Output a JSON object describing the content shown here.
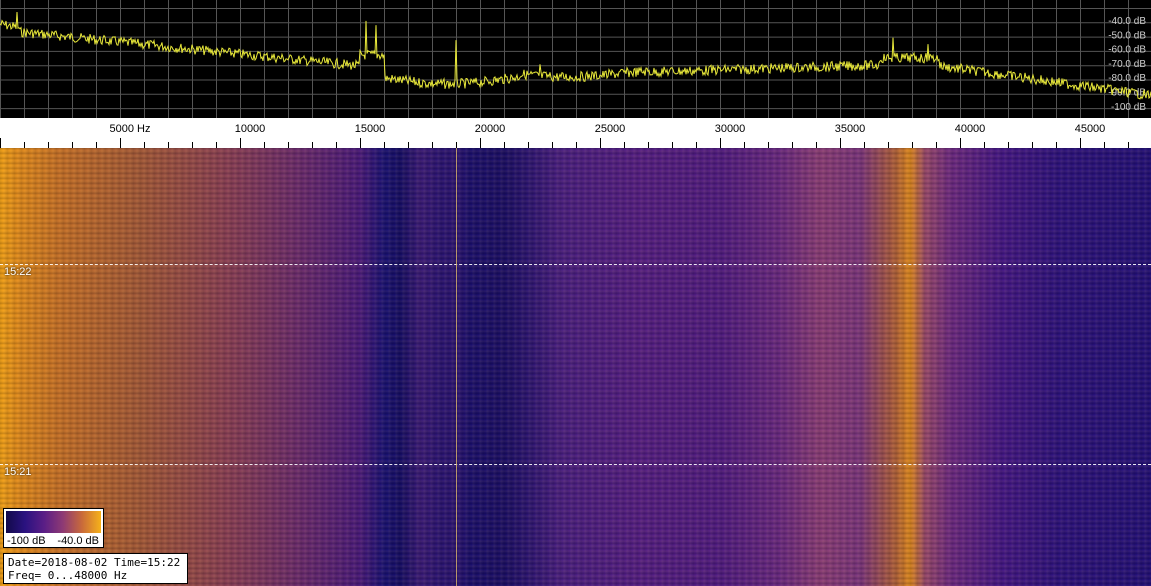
{
  "spectrum": {
    "db_labels": [
      "-40.0 dB",
      "-50.0 dB",
      "-60.0 dB",
      "-70.0 dB",
      "-80.0 dB",
      "-90.0 dB",
      "-100 dB"
    ],
    "trace_color": "#e8e83a",
    "grid_color": "#555555",
    "background": "#000000"
  },
  "axis": {
    "freq_labels": [
      "5000 Hz",
      "10000",
      "15000",
      "20000",
      "25000",
      "30000",
      "35000",
      "40000",
      "45000"
    ]
  },
  "waterfall": {
    "time_markers": [
      "15:22",
      "15:21"
    ],
    "marker_color": "#e7c36a"
  },
  "colorbar": {
    "min_label": "-100 dB",
    "max_label": "-40.0 dB"
  },
  "info": {
    "date_line": "Date=2018-08-02 Time=15:22",
    "freq_line": "Freq= 0...48000 Hz"
  }
}
